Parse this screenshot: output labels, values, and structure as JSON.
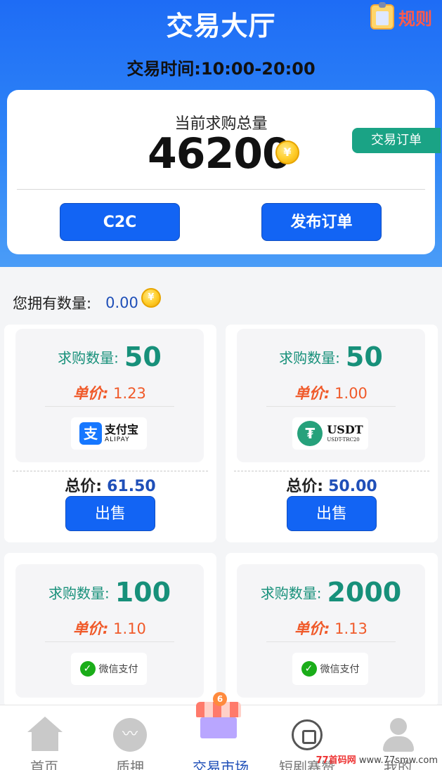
{
  "header": {
    "title": "交易大厅",
    "rules_label": "规则",
    "trade_time": "交易时间:10:00-20:00"
  },
  "summary": {
    "label": "当前求购总量",
    "total": "46200",
    "coin_symbol": "¥",
    "order_button": "交易订单",
    "c2c_button": "C2C",
    "publish_button": "发布订单"
  },
  "holding": {
    "label": "您拥有数量:",
    "value": "0.00"
  },
  "listing_labels": {
    "qty": "求购数量:",
    "price": "单价:",
    "total": "总价:",
    "sell": "出售"
  },
  "listings": [
    {
      "qty": "50",
      "price": "1.23",
      "total": "61.50",
      "payment": "alipay",
      "pay_cn": "支付宝",
      "pay_en": "ALIPAY",
      "pay_icon_glyph": "支"
    },
    {
      "qty": "50",
      "price": "1.00",
      "total": "50.00",
      "payment": "usdt",
      "pay_cn": "USDT",
      "pay_en": "USDT-TRC20",
      "pay_icon_glyph": "₮"
    },
    {
      "qty": "100",
      "price": "1.10",
      "payment": "wechat",
      "pay_cn": "微信支付",
      "pay_icon_glyph": "✓"
    },
    {
      "qty": "2000",
      "price": "1.13",
      "payment": "wechat",
      "pay_cn": "微信支付",
      "pay_icon_glyph": "✓"
    }
  ],
  "tabbar": {
    "items": [
      {
        "label": "首页",
        "icon": "home-icon"
      },
      {
        "label": "质押",
        "icon": "pulse-icon"
      },
      {
        "label": "交易市场",
        "icon": "shop-icon",
        "active": true
      },
      {
        "label": "短剧赛赞",
        "icon": "stop-icon"
      },
      {
        "label": "我的",
        "icon": "user-icon"
      }
    ],
    "pulse_glyph": "〰",
    "shop_badge": "6"
  },
  "watermark": {
    "prefix": "77首码网",
    "url": "www.77smw.com"
  },
  "colors": {
    "header_blue": "#1e6cf5",
    "button_blue": "#1264f4",
    "teal": "#1aa385",
    "qty_green": "#17907a",
    "price_orange": "#f05a2a",
    "value_blue": "#1f4fb8"
  }
}
